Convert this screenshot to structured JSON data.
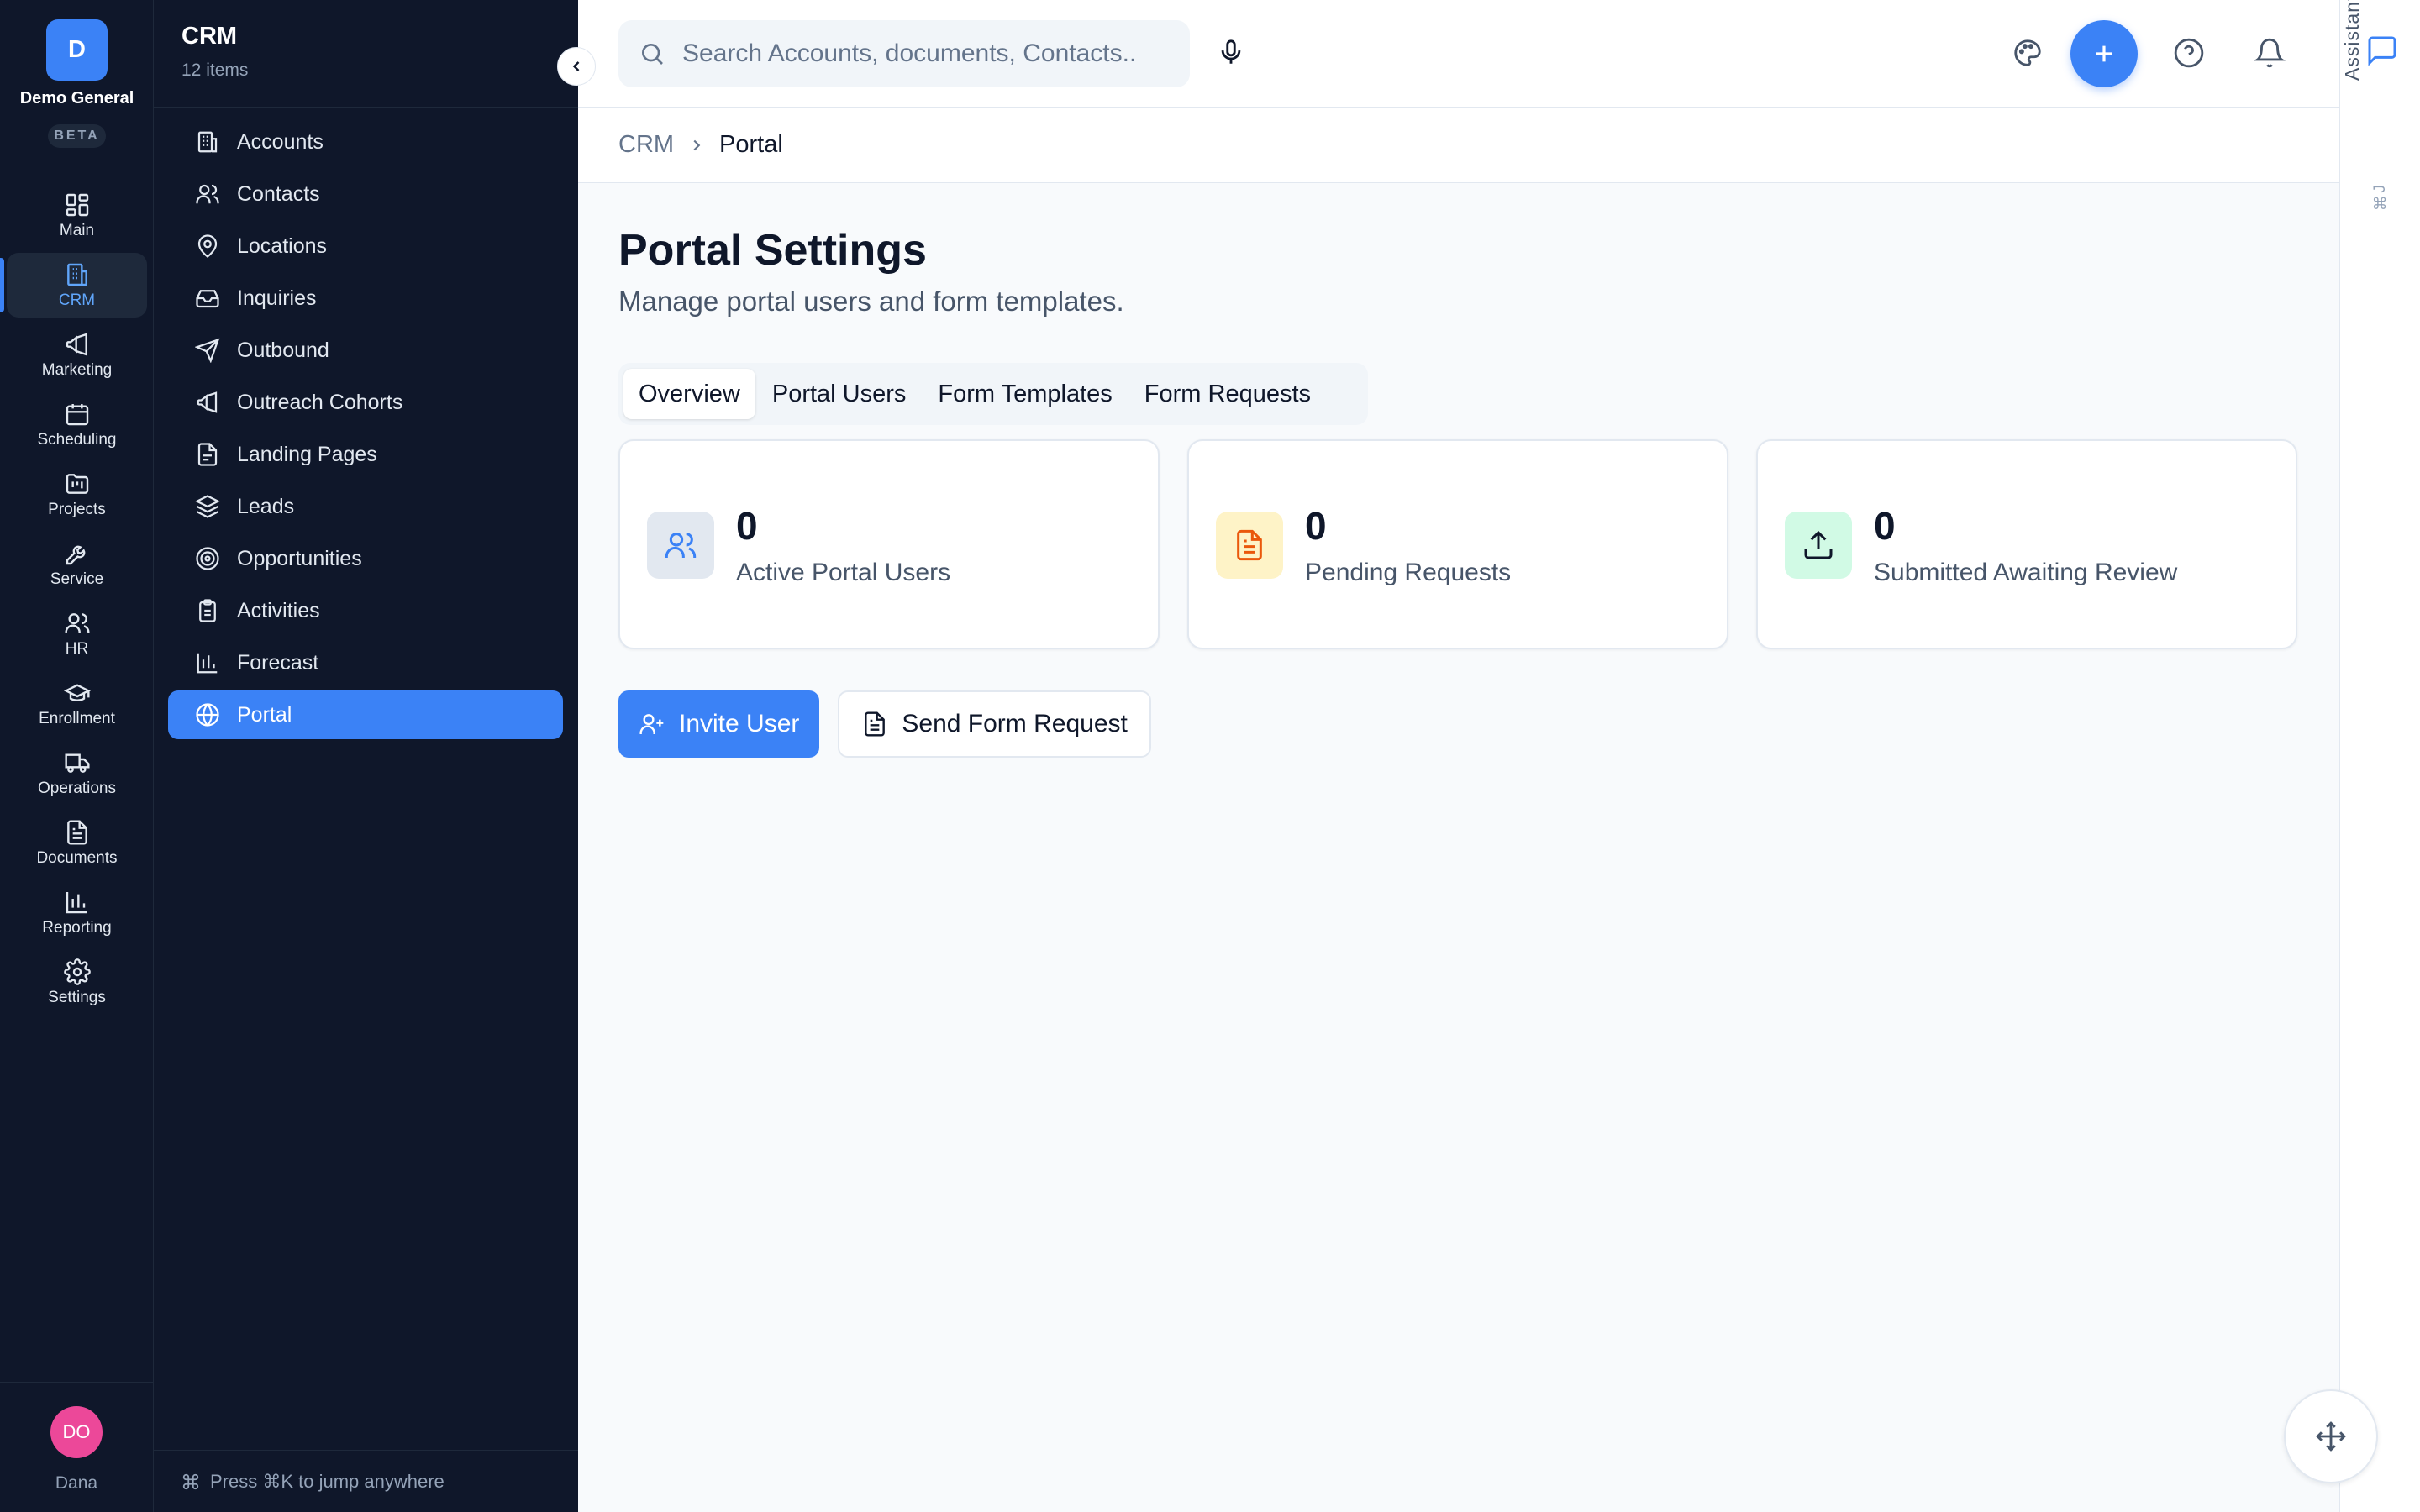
{
  "rail": {
    "logo_letter": "D",
    "org_name": "Demo General",
    "beta": "BETA",
    "items": [
      {
        "label": "Main",
        "icon": "grid-icon"
      },
      {
        "label": "CRM",
        "icon": "building-icon"
      },
      {
        "label": "Marketing",
        "icon": "megaphone-icon"
      },
      {
        "label": "Scheduling",
        "icon": "calendar-icon"
      },
      {
        "label": "Projects",
        "icon": "folder-kanban-icon"
      },
      {
        "label": "Service",
        "icon": "wrench-icon"
      },
      {
        "label": "HR",
        "icon": "users-icon"
      },
      {
        "label": "Enrollment",
        "icon": "graduation-cap-icon"
      },
      {
        "label": "Operations",
        "icon": "truck-icon"
      },
      {
        "label": "Documents",
        "icon": "file-text-icon"
      },
      {
        "label": "Reporting",
        "icon": "bar-chart-icon"
      },
      {
        "label": "Settings",
        "icon": "gear-icon"
      }
    ],
    "active": "CRM",
    "user_initials": "DO",
    "user_name": "Dana"
  },
  "subnav": {
    "title": "CRM",
    "count": "12 items",
    "items": [
      {
        "label": "Accounts",
        "icon": "building-icon"
      },
      {
        "label": "Contacts",
        "icon": "users-icon"
      },
      {
        "label": "Locations",
        "icon": "map-pin-icon"
      },
      {
        "label": "Inquiries",
        "icon": "inbox-icon"
      },
      {
        "label": "Outbound",
        "icon": "send-icon"
      },
      {
        "label": "Outreach Cohorts",
        "icon": "megaphone-icon"
      },
      {
        "label": "Landing Pages",
        "icon": "file-icon"
      },
      {
        "label": "Leads",
        "icon": "layers-icon"
      },
      {
        "label": "Opportunities",
        "icon": "target-icon"
      },
      {
        "label": "Activities",
        "icon": "clipboard-icon"
      },
      {
        "label": "Forecast",
        "icon": "bar-chart-icon"
      },
      {
        "label": "Portal",
        "icon": "globe-icon"
      }
    ],
    "active": "Portal",
    "footer": "Press ⌘K to jump anywhere"
  },
  "topbar": {
    "search_placeholder": "Search Accounts, documents, Contacts..."
  },
  "breadcrumb": {
    "root": "CRM",
    "current": "Portal"
  },
  "page": {
    "title": "Portal Settings",
    "subtitle": "Manage portal users and form templates.",
    "tabs": [
      "Overview",
      "Portal Users",
      "Form Templates",
      "Form Requests"
    ],
    "active_tab": "Overview",
    "stats": [
      {
        "value": "0",
        "label": "Active Portal Users",
        "icon": "users-icon",
        "color": "#3b82f6",
        "bg": "#e2e8f0"
      },
      {
        "value": "0",
        "label": "Pending Requests",
        "icon": "file-text-icon",
        "color": "#ea580c",
        "bg": "#fef3c7"
      },
      {
        "value": "0",
        "label": "Submitted Awaiting Review",
        "icon": "upload-icon",
        "color": "#0f172a",
        "bg": "#d1fae5"
      }
    ],
    "invite_label": "Invite User",
    "send_label": "Send Form Request"
  },
  "assistant": {
    "label": "Assistant",
    "shortcut": "⌘J"
  },
  "colors": {
    "accent": "#3b82f6",
    "sidebar": "#0f172a"
  }
}
